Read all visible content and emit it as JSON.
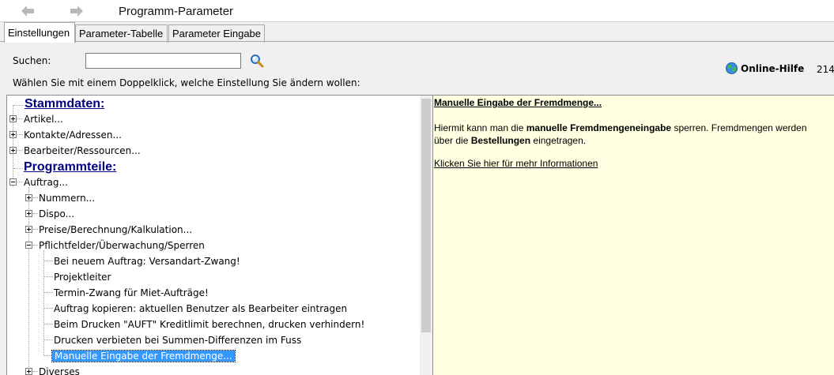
{
  "window": {
    "title": "Programm-Parameter"
  },
  "nav": {
    "back_icon": "arrow-left-icon",
    "forward_icon": "arrow-right-icon"
  },
  "tabs": [
    {
      "label": "Einstellungen",
      "active": true
    },
    {
      "label": "Parameter-Tabelle",
      "active": false
    },
    {
      "label": "Parameter Eingabe",
      "active": false
    }
  ],
  "search": {
    "label": "Suchen:",
    "value": "",
    "icon": "magnifier-icon"
  },
  "help": {
    "label": "Online-Hilfe",
    "icon": "globe-icon",
    "counter": "214"
  },
  "instructions": "Wählen Sie mit einem Doppelklick, welche Einstellung Sie ändern wollen:",
  "tree": {
    "items": [
      {
        "label": "Stammdaten:",
        "kind": "section"
      },
      {
        "label": "Artikel...",
        "kind": "collapsed"
      },
      {
        "label": "Kontakte/Adressen...",
        "kind": "collapsed"
      },
      {
        "label": "Bearbeiter/Ressourcen...",
        "kind": "collapsed"
      },
      {
        "label": "Programmteile:",
        "kind": "section"
      },
      {
        "label": "Auftrag...",
        "kind": "expanded"
      },
      {
        "label": "Nummern...",
        "kind": "collapsed"
      },
      {
        "label": "Dispo...",
        "kind": "collapsed"
      },
      {
        "label": "Preise/Berechnung/Kalkulation...",
        "kind": "collapsed"
      },
      {
        "label": "Pflichtfelder/Überwachung/Sperren",
        "kind": "expanded"
      },
      {
        "label": "Bei neuem Auftrag: Versandart-Zwang!",
        "kind": "leaf"
      },
      {
        "label": "Projektleiter",
        "kind": "leaf"
      },
      {
        "label": "Termin-Zwang für Miet-Aufträge!",
        "kind": "leaf"
      },
      {
        "label": "Auftrag kopieren: aktuellen Benutzer als Bearbeiter eintragen",
        "kind": "leaf"
      },
      {
        "label": "Beim Drucken \"AUFT\" Kreditlimit berechnen, drucken verhindern!",
        "kind": "leaf"
      },
      {
        "label": "Drucken verbieten bei Summen-Differenzen im Fuss",
        "kind": "leaf"
      },
      {
        "label": "Manuelle Eingabe der Fremdmenge...",
        "kind": "leaf",
        "selected": true
      },
      {
        "label": "Diverses",
        "kind": "collapsed"
      }
    ]
  },
  "info": {
    "title": "Manuelle Eingabe der Fremdmenge...",
    "text_1": "Hiermit kann man die ",
    "text_bold_1": "manuelle Fremdmengeneingabe",
    "text_2": " sperren. Fremdmengen werden über die ",
    "text_bold_2": "Bestellungen",
    "text_3": " eingetragen.",
    "link": "Klicken Sie hier für mehr Informationen"
  }
}
